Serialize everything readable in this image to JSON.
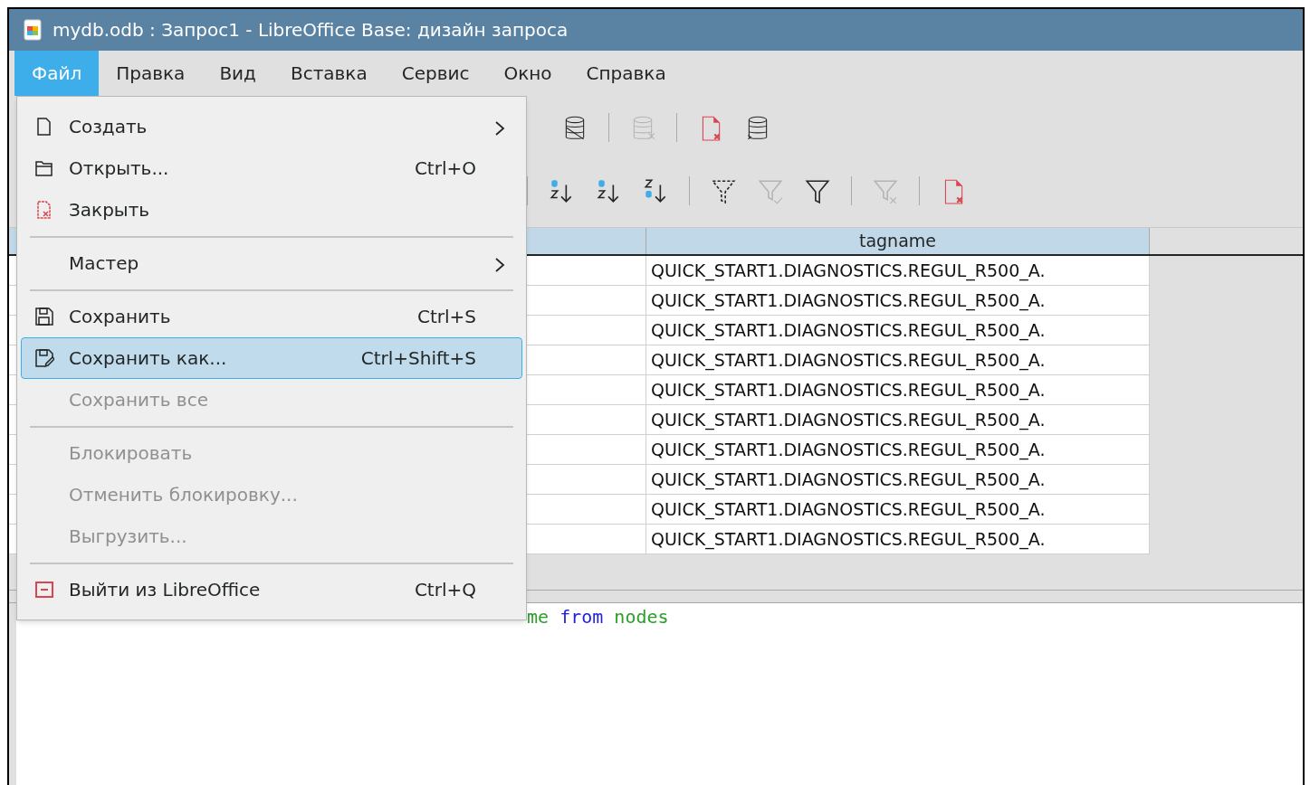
{
  "window": {
    "title": "mydb.odb : Запрос1 - LibreOffice Base: дизайн запроса"
  },
  "menubar": [
    {
      "label": "Файл",
      "selected": true
    },
    {
      "label": "Правка",
      "selected": false
    },
    {
      "label": "Вид",
      "selected": false
    },
    {
      "label": "Вставка",
      "selected": false
    },
    {
      "label": "Сервис",
      "selected": false
    },
    {
      "label": "Окно",
      "selected": false
    },
    {
      "label": "Справка",
      "selected": false
    }
  ],
  "toolbar_1": [
    {
      "kind": "db-edit",
      "disabled": false
    },
    {
      "kind": "separator"
    },
    {
      "kind": "db-delete",
      "disabled": true
    },
    {
      "kind": "separator"
    },
    {
      "kind": "doc-delete",
      "disabled": false
    },
    {
      "kind": "db-sql",
      "disabled": false
    }
  ],
  "toolbar_2": [
    {
      "kind": "separator"
    },
    {
      "kind": "sort-az",
      "disabled": false
    },
    {
      "kind": "sort-az",
      "disabled": false
    },
    {
      "kind": "sort-za",
      "disabled": false
    },
    {
      "kind": "separator"
    },
    {
      "kind": "filter-auto",
      "disabled": false
    },
    {
      "kind": "filter-apply",
      "disabled": true
    },
    {
      "kind": "filter",
      "disabled": false
    },
    {
      "kind": "separator"
    },
    {
      "kind": "filter-remove",
      "disabled": true
    },
    {
      "kind": "separator"
    },
    {
      "kind": "doc-delete",
      "disabled": false
    }
  ],
  "grid": {
    "columns": [
      "tagname"
    ],
    "rows": [
      "QUICK_START1.DIAGNOSTICS.REGUL_R500_A.",
      "QUICK_START1.DIAGNOSTICS.REGUL_R500_A.",
      "QUICK_START1.DIAGNOSTICS.REGUL_R500_A.",
      "QUICK_START1.DIAGNOSTICS.REGUL_R500_A.",
      "QUICK_START1.DIAGNOSTICS.REGUL_R500_A.",
      "QUICK_START1.DIAGNOSTICS.REGUL_R500_A.",
      "QUICK_START1.DIAGNOSTICS.REGUL_R500_A.",
      "QUICK_START1.DIAGNOSTICS.REGUL_R500_A.",
      "QUICK_START1.DIAGNOSTICS.REGUL_R500_A.",
      "QUICK_START1.DIAGNOSTICS.REGUL_R500_A."
    ]
  },
  "sql_editor": {
    "tokens": [
      {
        "text": "me",
        "kind": "identifier"
      },
      {
        "text": "from",
        "kind": "keyword"
      },
      {
        "text": "nodes",
        "kind": "identifier"
      }
    ]
  },
  "file_menu": [
    {
      "kind": "item",
      "label": "Создать",
      "submenu": true,
      "disabled": false,
      "selected": false
    },
    {
      "kind": "item",
      "label": "Открыть...",
      "shortcut": "Ctrl+O",
      "disabled": false,
      "selected": false
    },
    {
      "kind": "item",
      "label": "Закрыть",
      "disabled": false,
      "selected": false
    },
    {
      "kind": "separator"
    },
    {
      "kind": "item",
      "label": "Мастер",
      "submenu": true,
      "disabled": false,
      "selected": false
    },
    {
      "kind": "separator"
    },
    {
      "kind": "item",
      "label": "Сохранить",
      "shortcut": "Ctrl+S",
      "disabled": false,
      "selected": false
    },
    {
      "kind": "item",
      "label": "Сохранить как...",
      "shortcut": "Ctrl+Shift+S",
      "disabled": false,
      "selected": true
    },
    {
      "kind": "item",
      "label": "Сохранить все",
      "disabled": true,
      "selected": false
    },
    {
      "kind": "separator"
    },
    {
      "kind": "item",
      "label": "Блокировать",
      "disabled": true,
      "selected": false
    },
    {
      "kind": "item",
      "label": "Отменить блокировку...",
      "disabled": true,
      "selected": false
    },
    {
      "kind": "item",
      "label": "Выгрузить...",
      "disabled": true,
      "selected": false
    },
    {
      "kind": "separator"
    },
    {
      "kind": "item",
      "label": "Выйти из LibreOffice",
      "shortcut": "Ctrl+Q",
      "disabled": false,
      "selected": false
    }
  ]
}
